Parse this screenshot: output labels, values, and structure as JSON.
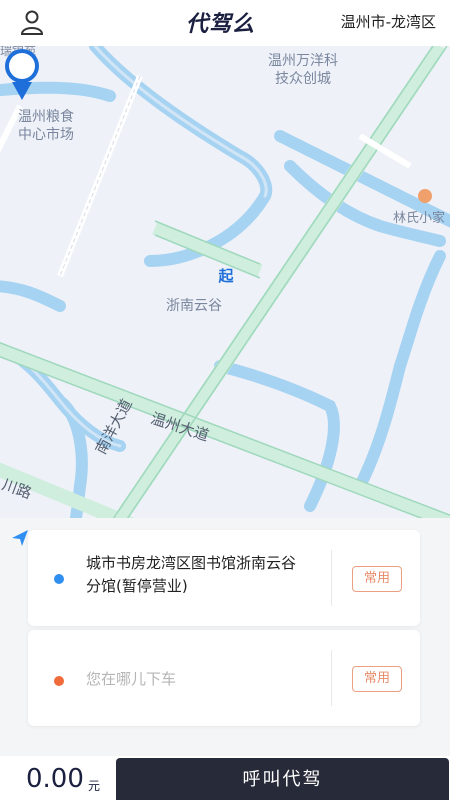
{
  "header": {
    "logo_text": "代驾么",
    "city": "温州市-龙湾区"
  },
  "map": {
    "labels": {
      "top_left_partial": "瑞锦苑",
      "grain_market": "温州粮食\n中心市场",
      "wanyang_city": "温州万洋科\n技众创城",
      "lin_clinic": "林氏小家",
      "pin_place": "浙南云谷"
    },
    "road_labels": {
      "wenzhou_avenue": "温州大道",
      "nanyang_avenue": "南洋大道",
      "left_road": "川路",
      "left_edge": "ɾ"
    },
    "pin_char": "起"
  },
  "trip": {
    "from_address": "城市书房龙湾区图书馆浙南云谷分馆(暂停营业)",
    "to_placeholder": "您在哪儿下车",
    "common_label_1": "常用",
    "common_label_2": "常用"
  },
  "footer": {
    "price": "0.00",
    "price_unit": "元",
    "call_label": "呼叫代驾"
  },
  "colors": {
    "primary_dark": "#272a38",
    "start_dot": "#2f8ef0",
    "end_dot": "#f06a3a",
    "accent_orange": "#e58b68",
    "water": "#a6d3f2",
    "road_green": "#cfeedd"
  }
}
